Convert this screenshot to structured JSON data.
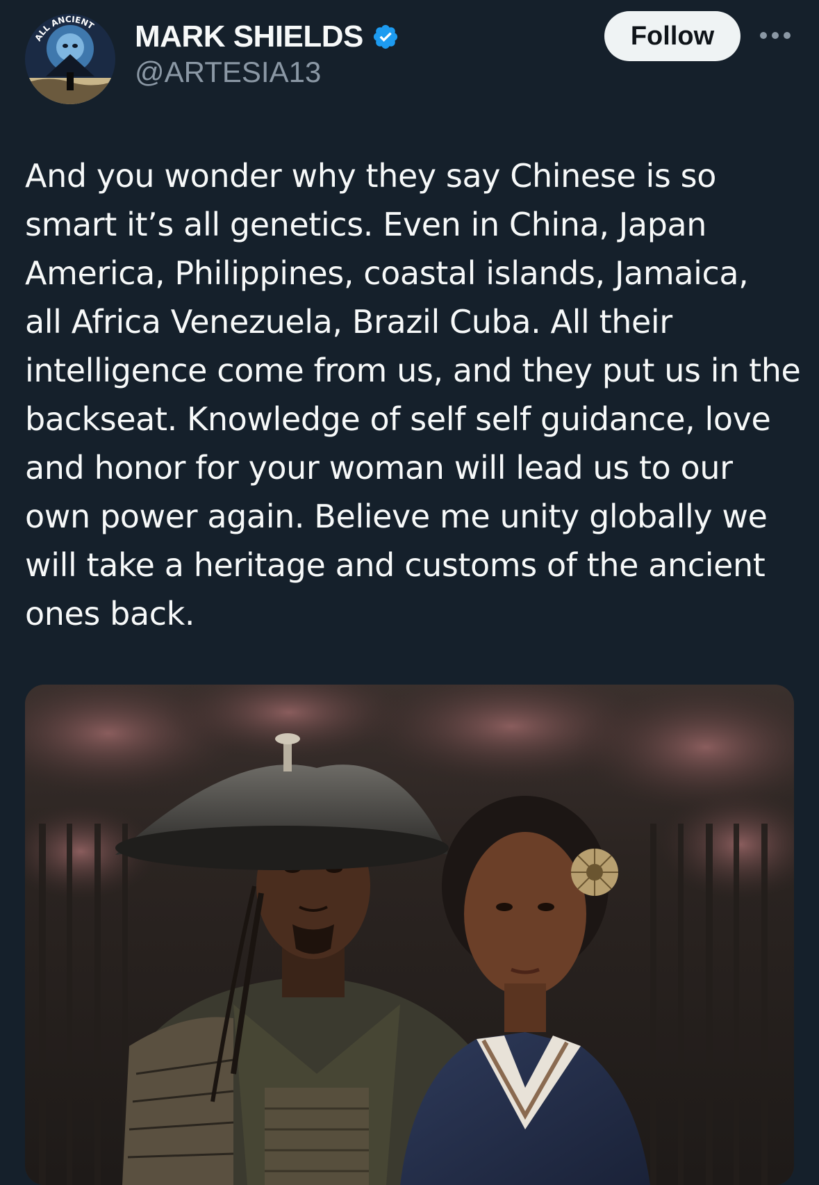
{
  "author": {
    "name": "MARK SHIELDS",
    "handle": "@ARTESIA13",
    "verified": true,
    "avatar_text": "ALL ANCIENT"
  },
  "actions": {
    "follow_label": "Follow",
    "more_icon": "more-horizontal-icon"
  },
  "tweet": {
    "text": "And you wonder why they say Chinese is so\nsmart it’s all genetics. Even in China, Japan\nAmerica, Philippines, coastal islands, Jamaica,\nall Africa Venezuela, Brazil Cuba. All their\nintelligence come from us, and they put us in the\nbackseat. Knowledge of self self guidance, love\nand honor for your woman will lead us to our\nown power again. Believe me unity globally we\nwill take a heritage and customs of the ancient\nones back."
  },
  "colors": {
    "background": "#15202b",
    "text_primary": "#f7f9f9",
    "text_secondary": "#8b98a5",
    "verified_blue": "#1d9bf0",
    "follow_bg": "#eff3f4"
  }
}
